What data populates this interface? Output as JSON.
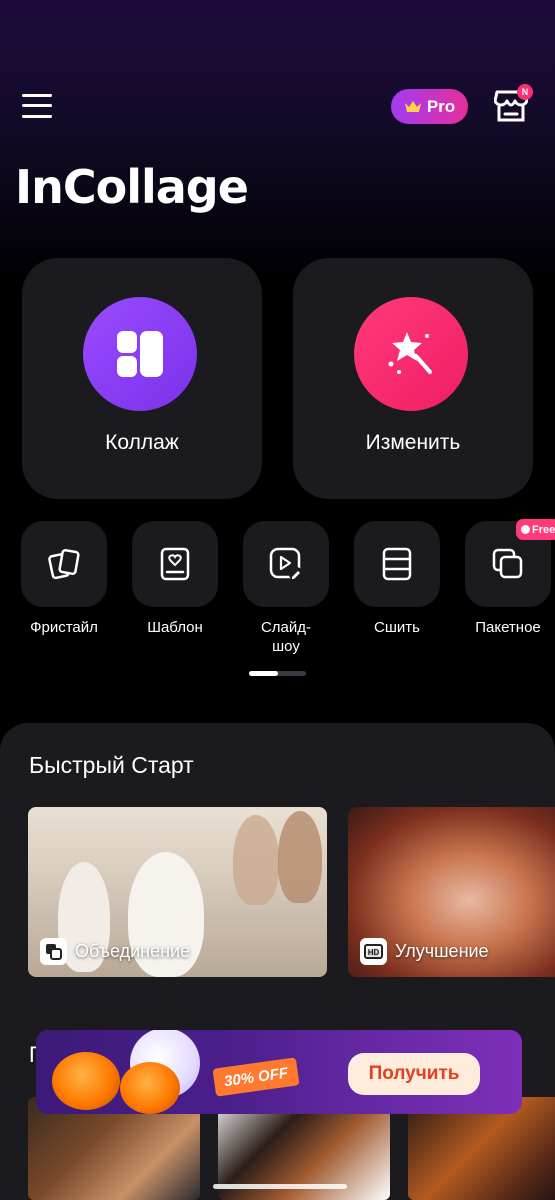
{
  "header": {
    "menu_icon": "hamburger-menu-icon",
    "pro_label": "Pro",
    "pro_icon": "crown-icon",
    "store_icon": "store-icon",
    "store_badge": "N",
    "logo": "InCollage"
  },
  "main_actions": [
    {
      "label": "Коллаж",
      "icon": "collage-grid-icon",
      "color": "#8a3ff7"
    },
    {
      "label": "Изменить",
      "icon": "magic-wand-icon",
      "color": "#f52b6e"
    }
  ],
  "tools": [
    {
      "label": "Фристайл",
      "icon": "freestyle-cards-icon"
    },
    {
      "label": "Шаблон",
      "icon": "template-heart-icon"
    },
    {
      "label": "Слайд-\nшоу",
      "icon": "slideshow-play-icon"
    },
    {
      "label": "Сшить",
      "icon": "stitch-icon"
    },
    {
      "label": "Пакетное",
      "icon": "batch-icon",
      "badge": "Free"
    }
  ],
  "quick_start": {
    "title": "Быстрый Старт",
    "items": [
      {
        "label": "Объединение",
        "icon": "merge-icon"
      },
      {
        "label": "Улучшение",
        "icon": "hd-icon"
      }
    ]
  },
  "section2": {
    "title": "П"
  },
  "promo": {
    "discount": "30% OFF",
    "button": "Получить"
  }
}
